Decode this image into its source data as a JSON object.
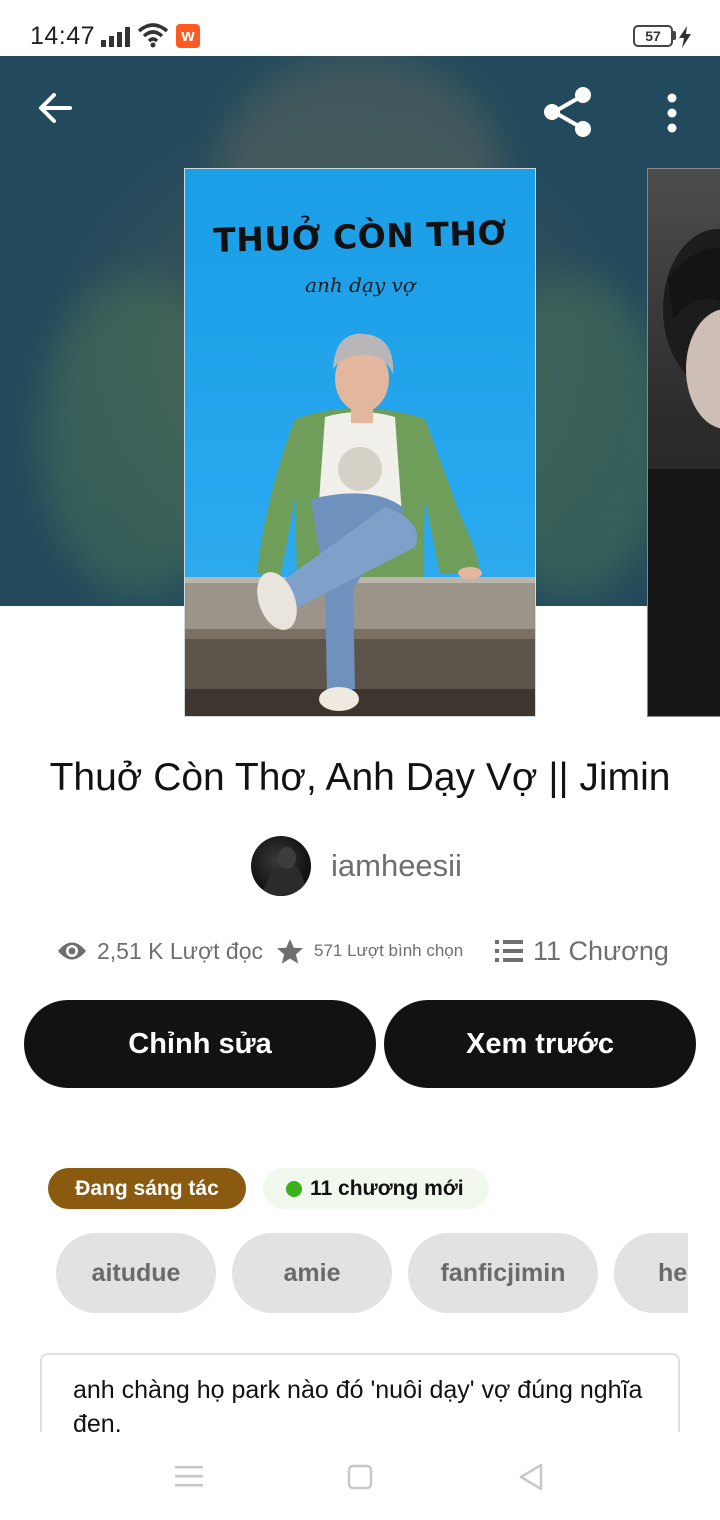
{
  "status_bar": {
    "time": "14:47",
    "battery": "57",
    "app_badge": "w",
    "icons": [
      "signal-icon",
      "wifi-icon",
      "wattpad-notification-icon",
      "battery-icon",
      "charging-icon"
    ]
  },
  "header": {
    "icons": [
      "back-arrow-icon",
      "share-icon",
      "more-vertical-icon"
    ]
  },
  "cover": {
    "title": "THUỞ CÒN THƠ",
    "subtitle": "anh dạy vợ"
  },
  "story": {
    "title": "Thuở Còn Thơ, Anh Dạy Vợ || Jimin",
    "author": "iamheesii",
    "reads": "2,51 K Lượt đọc",
    "votes": "571 Lượt bình chọn",
    "parts": "11 Chương"
  },
  "actions": {
    "edit_label": "Chỉnh sửa",
    "preview_label": "Xem trước"
  },
  "badges": {
    "status": "Đang sáng tác",
    "new_parts": "11 chương mới"
  },
  "tags": [
    "aitudue",
    "amie",
    "fanficjimin",
    "he"
  ],
  "description": "anh chàng họ park nào đó 'nuôi dạy' vợ đúng nghĩa đen.",
  "colors": {
    "banner": "#234a5c",
    "cover_background": "#27a7ee",
    "button": "#121212",
    "status_tag": "#8a5a10",
    "new_dot": "#3cb01c",
    "tag_background": "#e2e2e2"
  }
}
